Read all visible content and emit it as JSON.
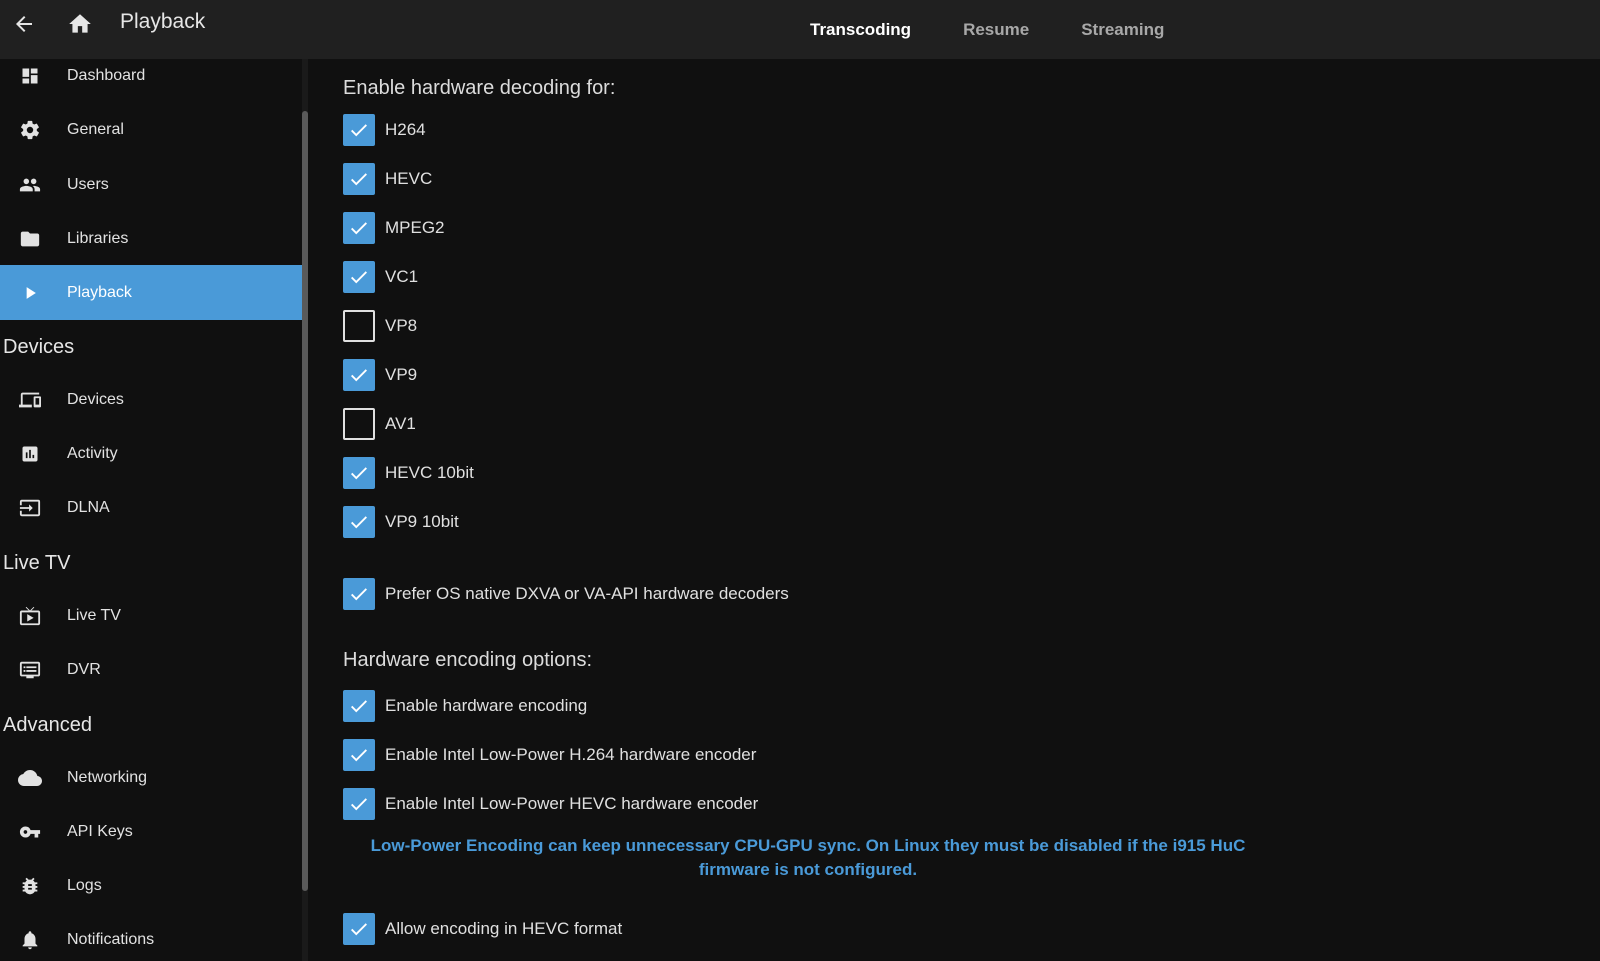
{
  "header": {
    "title": "Playback",
    "tabs": [
      {
        "label": "Transcoding",
        "active": true
      },
      {
        "label": "Resume",
        "active": false
      },
      {
        "label": "Streaming",
        "active": false
      }
    ]
  },
  "sidebar": {
    "items": [
      {
        "label": "Dashboard",
        "icon": "dashboard-icon"
      },
      {
        "label": "General",
        "icon": "gear-icon"
      },
      {
        "label": "Users",
        "icon": "people-icon"
      },
      {
        "label": "Libraries",
        "icon": "folder-icon"
      },
      {
        "label": "Playback",
        "icon": "play-icon",
        "active": true
      }
    ],
    "sections": {
      "devices": {
        "title": "Devices",
        "items": [
          {
            "label": "Devices",
            "icon": "devices-icon"
          },
          {
            "label": "Activity",
            "icon": "chart-icon"
          },
          {
            "label": "DLNA",
            "icon": "input-icon"
          }
        ]
      },
      "livetv": {
        "title": "Live TV",
        "items": [
          {
            "label": "Live TV",
            "icon": "tv-icon"
          },
          {
            "label": "DVR",
            "icon": "dvr-icon"
          }
        ]
      },
      "advanced": {
        "title": "Advanced",
        "items": [
          {
            "label": "Networking",
            "icon": "cloud-icon"
          },
          {
            "label": "API Keys",
            "icon": "key-icon"
          },
          {
            "label": "Logs",
            "icon": "bug-icon"
          },
          {
            "label": "Notifications",
            "icon": "bell-icon"
          }
        ]
      }
    }
  },
  "decoding": {
    "title": "Enable hardware decoding for:",
    "codecs": [
      {
        "label": "H264",
        "checked": true
      },
      {
        "label": "HEVC",
        "checked": true
      },
      {
        "label": "MPEG2",
        "checked": true
      },
      {
        "label": "VC1",
        "checked": true
      },
      {
        "label": "VP8",
        "checked": false
      },
      {
        "label": "VP9",
        "checked": true
      },
      {
        "label": "AV1",
        "checked": false
      },
      {
        "label": "HEVC 10bit",
        "checked": true
      },
      {
        "label": "VP9 10bit",
        "checked": true
      }
    ],
    "prefer_native": {
      "label": "Prefer OS native DXVA or VA-API hardware decoders",
      "checked": true
    }
  },
  "encoding": {
    "title": "Hardware encoding options:",
    "options": [
      {
        "label": "Enable hardware encoding",
        "checked": true
      },
      {
        "label": "Enable Intel Low-Power H.264 hardware encoder",
        "checked": true
      },
      {
        "label": "Enable Intel Low-Power HEVC hardware encoder",
        "checked": true
      }
    ],
    "note": "Low-Power Encoding can keep unnecessary CPU-GPU sync. On Linux they must be disabled if the i915 HuC firmware is not configured.",
    "hevc_format": {
      "label": "Allow encoding in HEVC format",
      "checked": true
    }
  },
  "colors": {
    "accent": "#4a9ad8",
    "header_bg": "#202020",
    "page_bg": "#101010"
  }
}
